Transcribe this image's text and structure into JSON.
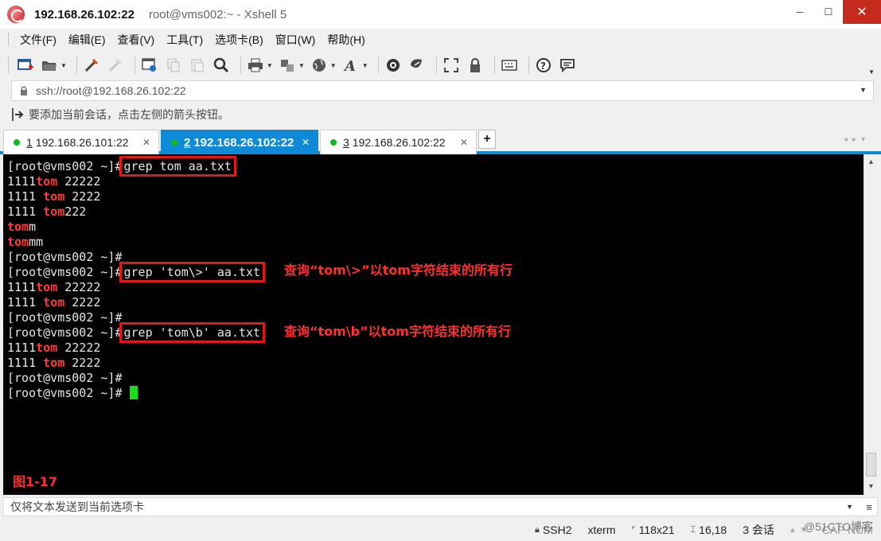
{
  "window": {
    "title_host": "192.168.26.102:22",
    "title_rest": "root@vms002:~ - Xshell 5",
    "minimize": "─",
    "maximize": "☐",
    "close": "✕"
  },
  "menu": {
    "items": [
      "文件(F)",
      "编辑(E)",
      "查看(V)",
      "工具(T)",
      "选项卡(B)",
      "窗口(W)",
      "帮助(H)"
    ]
  },
  "toolbar": {
    "icons": [
      "new-session-icon",
      "open-folder-icon",
      "reconnect-icon",
      "disconnect-icon",
      "properties-icon",
      "copy-icon",
      "paste-icon",
      "find-icon",
      "print-icon",
      "transfer-icon",
      "globe-icon",
      "font-icon",
      "xftp-icon",
      "xmanager-icon",
      "fullscreen-icon",
      "lock-icon",
      "keyboard-icon",
      "help-icon",
      "chat-icon"
    ]
  },
  "address": {
    "url": "ssh://root@192.168.26.102:22"
  },
  "hint": {
    "text": "要添加当前会话，点击左侧的箭头按钮。"
  },
  "tabs": [
    {
      "num": "1",
      "label": "192.168.26.101:22",
      "active": false
    },
    {
      "num": "2",
      "label": "192.168.26.102:22",
      "active": true
    },
    {
      "num": "3",
      "label": "192.168.26.102:22",
      "active": false
    }
  ],
  "tab_add": "+",
  "terminal": {
    "prompt": "[root@vms002 ~]#",
    "cmd1": "grep tom aa.txt",
    "cmd2": "grep 'tom\\>' aa.txt",
    "cmd3": "grep 'tom\\b' aa.txt",
    "match": "tom",
    "l1a": "1111",
    "l1b": " 22222",
    "l2a": "1111 ",
    "l2b": " 2222",
    "l3a": "1111 ",
    "l3b": "222",
    "l4b": "m",
    "l5b": "mm",
    "annotation1": "查询“tom\\>”以tom字符结束的所有行",
    "annotation2": "查询“tom\\b”以tom字符结束的所有行",
    "figure_label": "图1-17"
  },
  "send_bar": {
    "text": "仅将文本发送到当前选项卡"
  },
  "status": {
    "protocol": "SSH2",
    "terminal_type": "xterm",
    "size": "118x21",
    "cursor_pos": "16,18",
    "sessions": "3 会话",
    "caps": "CAP NUM"
  },
  "watermark": "@51CTO博客"
}
